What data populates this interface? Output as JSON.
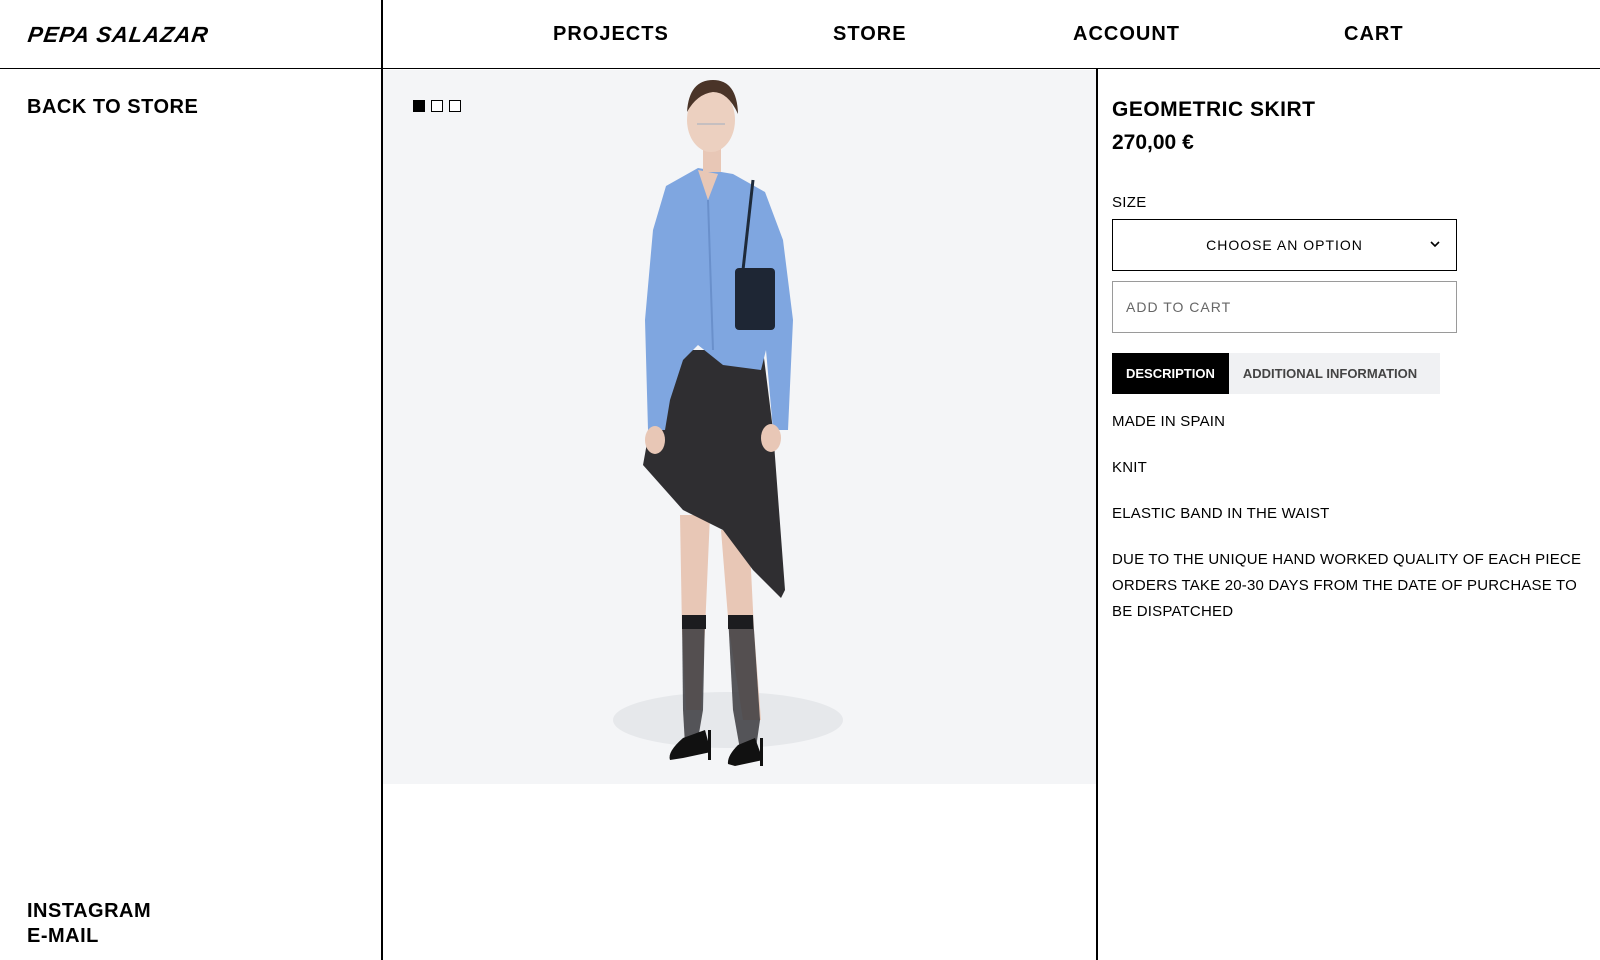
{
  "header": {
    "logo": "PEPA SALAZAR",
    "nav": [
      "PROJECTS",
      "STORE",
      "ACCOUNT",
      "CART"
    ]
  },
  "sidebar": {
    "back": "BACK TO STORE",
    "links": [
      "INSTAGRAM",
      "E-MAIL"
    ]
  },
  "gallery": {
    "image_count": 3,
    "active_index": 0,
    "image": "model-wearing-blue-shirt-and-asymmetric-black-skirt",
    "background": "#f4f5f7"
  },
  "product": {
    "title": "GEOMETRIC SKIRT",
    "price": "270,00 €",
    "size_label": "SIZE",
    "size_placeholder": "CHOOSE AN OPTION",
    "add_to_cart": "ADD TO CART",
    "tabs": [
      {
        "label": "DESCRIPTION",
        "active": true
      },
      {
        "label": "ADDITIONAL INFORMATION",
        "active": false
      }
    ],
    "description": [
      "MADE IN SPAIN",
      "KNIT",
      "ELASTIC BAND IN THE WAIST",
      "DUE TO THE UNIQUE HAND WORKED QUALITY OF EACH PIECE ORDERS TAKE 20-30 DAYS FROM THE DATE OF PURCHASE TO BE DISPATCHED"
    ]
  }
}
